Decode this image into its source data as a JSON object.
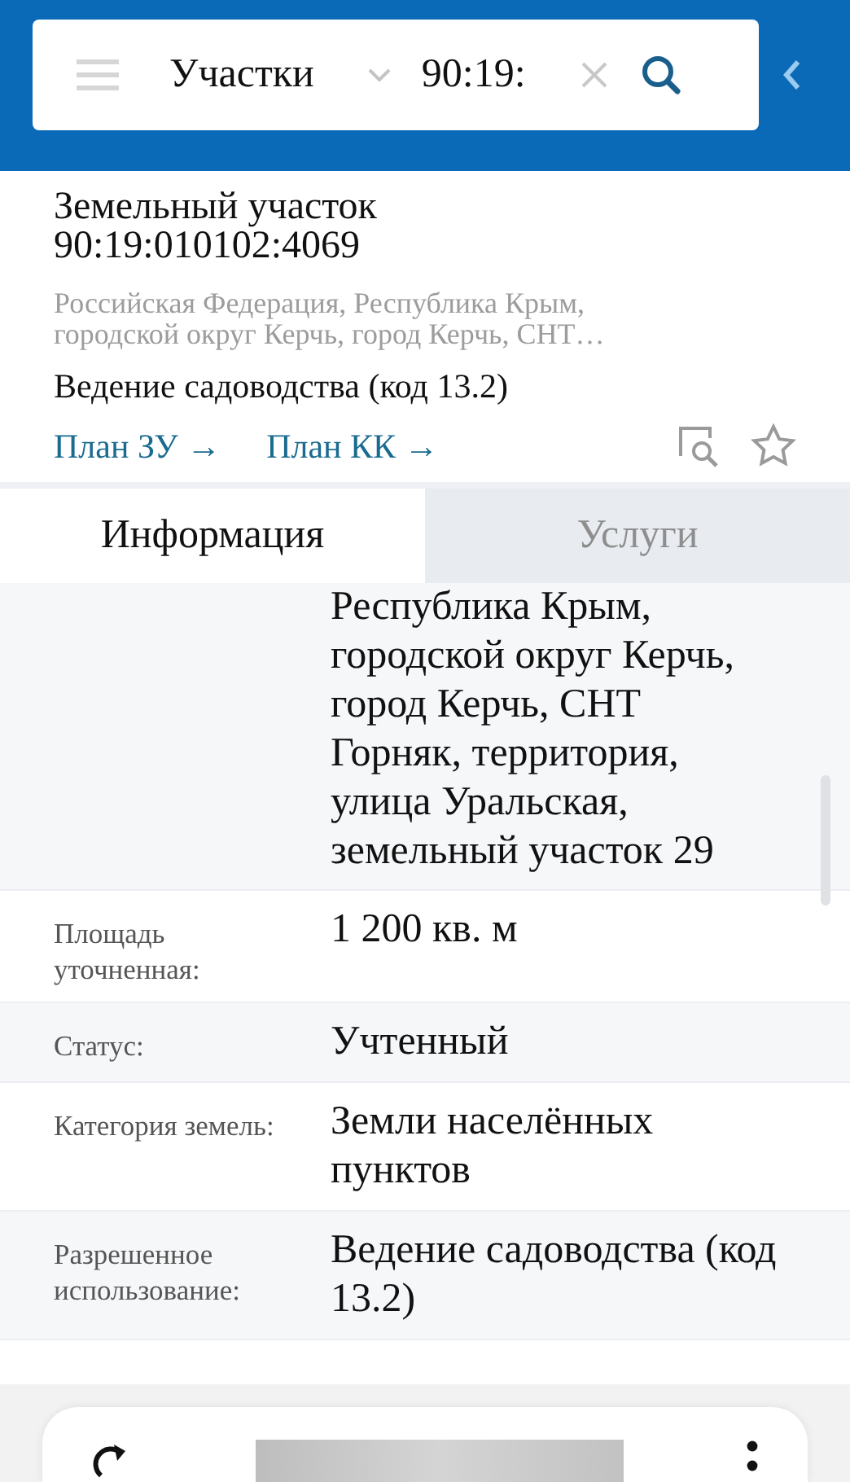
{
  "search_bar": {
    "category": "Участки",
    "query": "90:19:"
  },
  "object": {
    "title": "Земельный участок 90:19:010102:4069",
    "address": "Российская Федерация, Республика Крым, городской округ Керчь, город Керчь, СНТ…",
    "purpose": "Ведение садоводства (код 13.2)",
    "links": [
      "План ЗУ →",
      "План КК →"
    ],
    "favorite": false
  },
  "tabs": [
    {
      "label": "Информация",
      "selected": true
    },
    {
      "label": "Услуги",
      "selected": false
    }
  ],
  "fields": [
    {
      "value": "Республика Крым, городской округ Керчь, город Керчь, СНТ Горняк, территория, улица Уральская, земельный участок 29"
    },
    {
      "label": "Площадь уточненная:",
      "value": "1 200 кв. м"
    },
    {
      "label": "Статус:",
      "value": "Учтенный"
    },
    {
      "label": "Категория земель:",
      "value": "Земли населённых пунктов"
    },
    {
      "label": "Разрешенное использование:",
      "value": "Ведение садоводства (код 13.2)"
    }
  ]
}
